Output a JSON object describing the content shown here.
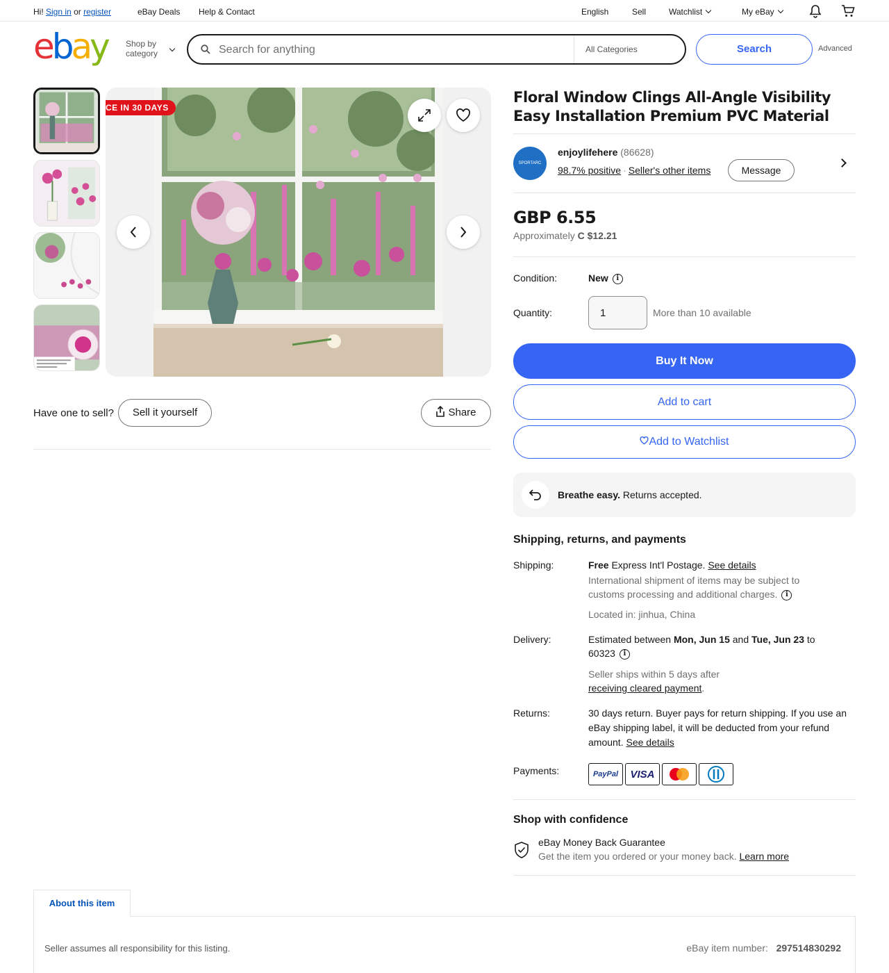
{
  "topnav": {
    "hi": "Hi!",
    "sign_in": "Sign in",
    "or": "or",
    "register": "register",
    "deals": "eBay Deals",
    "help": "Help & Contact",
    "language": "English",
    "sell": "Sell",
    "watchlist": "Watchlist",
    "my_ebay": "My eBay"
  },
  "header": {
    "logo_letters": [
      "e",
      "b",
      "a",
      "y"
    ],
    "shop_by_line1": "Shop by",
    "shop_by_line2": "category",
    "search_placeholder": "Search for anything",
    "category": "All Categories",
    "search_button": "Search",
    "advanced": "Advanced"
  },
  "gallery": {
    "ribbon": "CE IN 30 DAYS",
    "thumbnails": 4
  },
  "below_gallery": {
    "have_one": "Have one to sell?",
    "sell_it": "Sell it yourself",
    "share": "Share"
  },
  "listing": {
    "title": "Floral Window Clings All-Angle Visibility Easy Installation Premium PVC Material",
    "seller": {
      "avatar_text": "SPORTARC",
      "name": "enjoylifehere",
      "feedback_count": "(86628)",
      "positive": "98.7% positive",
      "other_items": "Seller's other items",
      "message": "Message"
    },
    "price": "GBP 6.55",
    "approx_label": "Approximately",
    "approx_value": "C $12.21",
    "condition_label": "Condition:",
    "condition_value": "New",
    "quantity_label": "Quantity:",
    "quantity_value": "1",
    "available": "More than 10 available",
    "buy_now": "Buy It Now",
    "add_to_cart": "Add to cart",
    "add_to_watchlist": "Add to Watchlist"
  },
  "returns_banner": {
    "bold": "Breathe easy.",
    "text": "Returns accepted."
  },
  "shipping_section": {
    "heading": "Shipping, returns, and payments",
    "shipping_label": "Shipping:",
    "shipping_free": "Free",
    "shipping_text": "Express Int'l Postage.",
    "see_details": "See details",
    "intl_note": "International shipment of items may be subject to customs processing and additional charges.",
    "located": "Located in: jinhua, China",
    "delivery_label": "Delivery:",
    "delivery_pre": "Estimated between",
    "delivery_start": "Mon, Jun 15",
    "delivery_and": "and",
    "delivery_end": "Tue, Jun 23",
    "delivery_to": "to",
    "delivery_zip": "60323",
    "ships_within": "Seller ships within 5 days after",
    "cleared_payment": "receiving cleared payment",
    "period": ".",
    "returns_label": "Returns:",
    "returns_text": "30 days return. Buyer pays for return shipping. If you use an eBay shipping label, it will be deducted from your refund amount.",
    "returns_see_details": "See details",
    "payments_label": "Payments:",
    "payment_methods": [
      "PayPal",
      "VISA",
      "Mastercard",
      "Diners Club"
    ]
  },
  "confidence": {
    "heading": "Shop with confidence",
    "guarantee": "eBay Money Back Guarantee",
    "guarantee_text": "Get the item you ordered or your money back.",
    "learn_more": "Learn more"
  },
  "about": {
    "tab": "About this item",
    "responsibility": "Seller assumes all responsibility for this listing.",
    "item_number_label": "eBay item number:",
    "item_number": "297514830292"
  }
}
